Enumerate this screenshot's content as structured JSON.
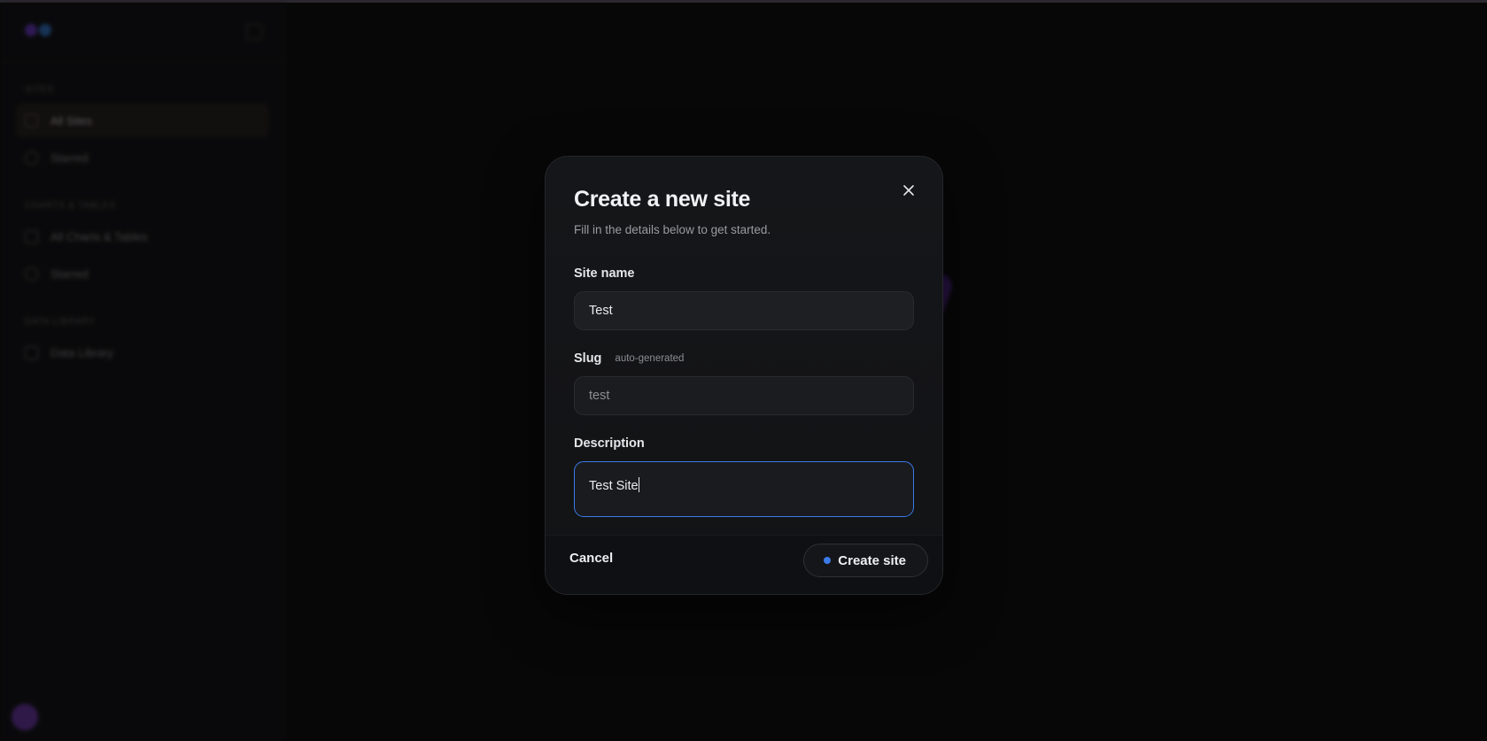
{
  "colors": {
    "accent": "#3b7be8",
    "brand_purple": "#7d3fc4",
    "logo_left": "#7b3fe4",
    "logo_right": "#3a86e8"
  },
  "sidebar": {
    "sections": [
      {
        "heading": "SITES",
        "items": [
          {
            "label": "All Sites",
            "icon": "grid-icon",
            "active": true
          },
          {
            "label": "Starred",
            "icon": "star-icon",
            "active": false
          }
        ]
      },
      {
        "heading": "CHARTS & TABLES",
        "items": [
          {
            "label": "All Charts & Tables",
            "icon": "chart-icon",
            "active": false
          },
          {
            "label": "Starred",
            "icon": "star-icon",
            "active": false
          }
        ]
      },
      {
        "heading": "DATA LIBRARY",
        "items": [
          {
            "label": "Data Library",
            "icon": "database-icon",
            "active": false
          }
        ]
      }
    ]
  },
  "modal": {
    "title": "Create a new site",
    "subtitle": "Fill in the details below to get started.",
    "close_icon": "close-icon",
    "fields": {
      "site_name": {
        "label": "Site name",
        "value": "Test"
      },
      "slug": {
        "label": "Slug",
        "hint": "auto-generated",
        "value": "test"
      },
      "description": {
        "label": "Description",
        "value": "Test Site"
      }
    },
    "footer": {
      "cancel_label": "Cancel",
      "create_label": "Create site"
    }
  }
}
